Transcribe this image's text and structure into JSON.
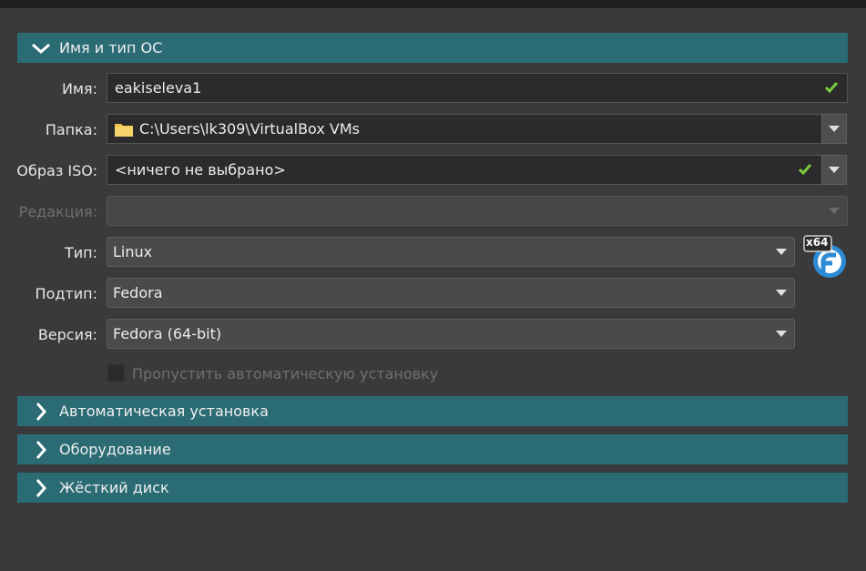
{
  "sections": {
    "name_os": {
      "title": "Имя и тип ОС",
      "expanded": true
    },
    "auto_install": {
      "title": "Автоматическая установка",
      "expanded": false
    },
    "hardware": {
      "title": "Оборудование",
      "expanded": false
    },
    "hard_disk": {
      "title": "Жёсткий диск",
      "expanded": false
    }
  },
  "form": {
    "name": {
      "label": "Имя:",
      "value": "eakiseleva1",
      "valid": true
    },
    "folder": {
      "label": "Папка:",
      "value": "C:\\Users\\lk309\\VirtualBox VMs"
    },
    "iso": {
      "label": "Образ ISO:",
      "value": "<ничего не выбрано>",
      "valid": true
    },
    "edition": {
      "label": "Редакция:",
      "value": "",
      "disabled": true
    },
    "type": {
      "label": "Тип:",
      "value": "Linux"
    },
    "subtype": {
      "label": "Подтип:",
      "value": "Fedora"
    },
    "version": {
      "label": "Версия:",
      "value": "Fedora (64-bit)"
    },
    "skip_unattended": {
      "label": "Пропустить автоматическую установку",
      "checked": false,
      "disabled": true
    }
  },
  "os_icon": {
    "badge": "x64",
    "name": "fedora-icon"
  },
  "colors": {
    "background": "#3a3a3c",
    "section_header": "#2a6b74",
    "valid_check": "#7ccc3c",
    "folder": "#f2c14e"
  }
}
